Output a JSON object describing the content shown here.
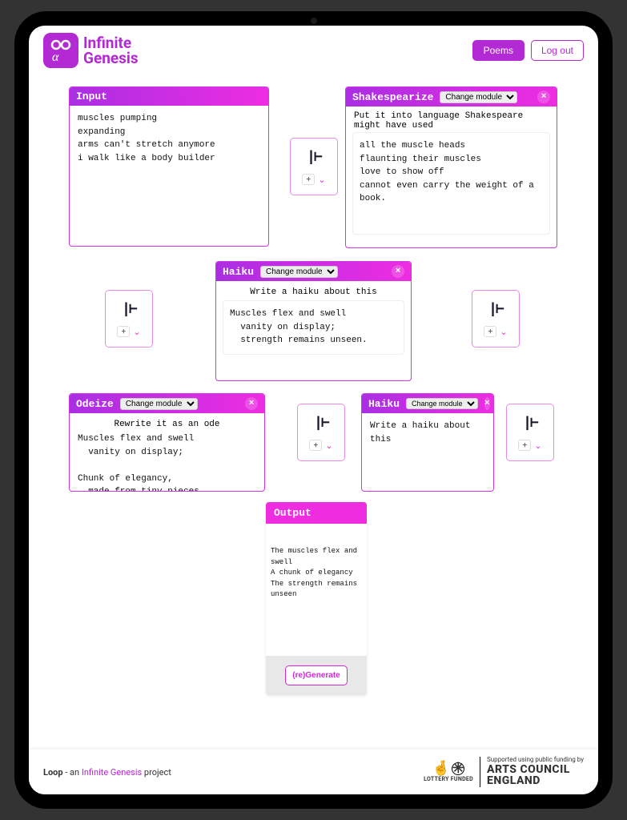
{
  "brand": {
    "line1": "Infinite",
    "line2": "Genesis"
  },
  "header": {
    "poems_btn": "Poems",
    "logout_btn": "Log out"
  },
  "modules": {
    "input": {
      "title": "Input",
      "text": "muscles pumping\nexpanding\narms can't stretch anymore\ni walk like a body builder"
    },
    "shakespearize": {
      "title": "Shakespearize",
      "select_label": "Change module",
      "desc": "Put it into language Shakespeare might have used",
      "text": "all the muscle heads\nflaunting their muscles\nlove to show off\ncannot even carry the weight of a book."
    },
    "haiku1": {
      "title": "Haiku",
      "select_label": "Change module",
      "desc": "Write a haiku about this",
      "text": "Muscles flex and swell\n  vanity on display;\n  strength remains unseen."
    },
    "odeize": {
      "title": "Odeize",
      "select_label": "Change module",
      "desc": "Rewrite it as an ode",
      "text": "Muscles flex and swell\n  vanity on display;\n\nChunk of elegancy,\n  made from tiny pieces,\n  more beautiful than a sunset.\n  strength remains unseen."
    },
    "haiku2": {
      "title": "Haiku",
      "select_label": "Change module",
      "desc": "Write a haiku about this"
    },
    "output": {
      "title": "Output",
      "text": "The muscles flex and swell\nA chunk of elegancy\nThe strength remains unseen",
      "regen_btn": "(re)Generate"
    }
  },
  "footer": {
    "prefix": "Loop",
    "middle": " - an ",
    "link": "Infinite Genesis",
    "suffix": " project",
    "lottery": "LOTTERY FUNDED",
    "supported": "Supported using public funding by",
    "arts1": "ARTS COUNCIL",
    "arts2": "ENGLAND"
  }
}
